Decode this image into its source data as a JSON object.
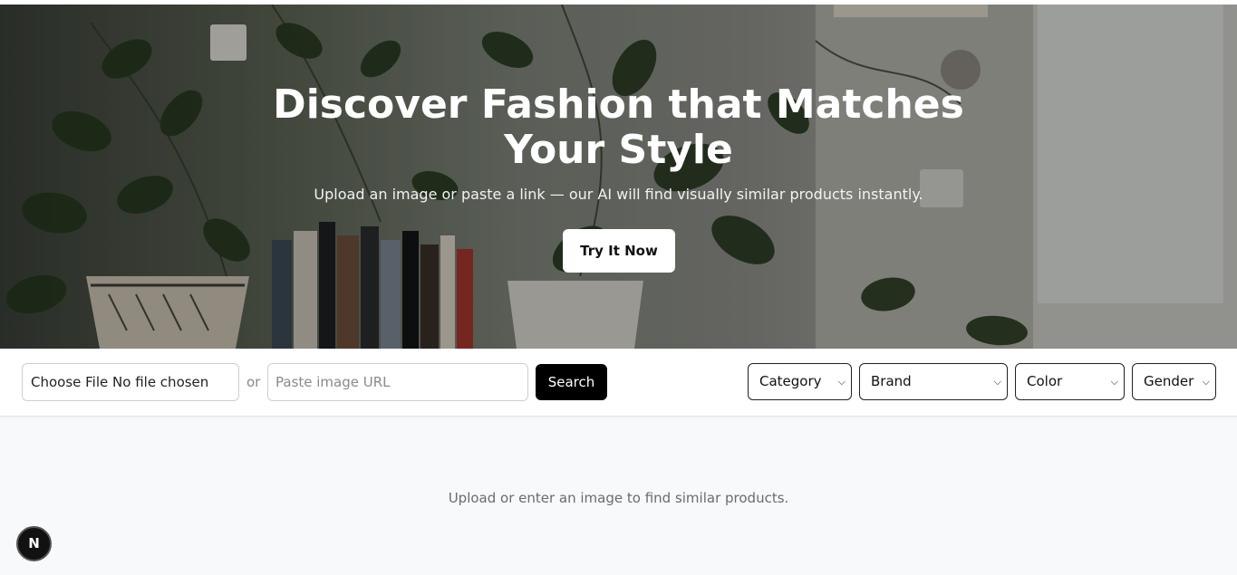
{
  "hero": {
    "title_line1": "Discover Fashion that Matches",
    "title_line2": "Your Style",
    "subtitle": "Upload an image or paste a link — our AI will find visually similar products instantly.",
    "cta_label": "Try It Now"
  },
  "search": {
    "file_button": "Choose File",
    "file_status": "No file chosen",
    "or_text": "or",
    "url_placeholder": "Paste image URL",
    "url_value": "",
    "search_label": "Search"
  },
  "filters": {
    "category": "Category",
    "brand": "Brand",
    "color": "Color",
    "gender": "Gender"
  },
  "empty_state": "Upload or enter an image to find similar products.",
  "dev_badge": "N",
  "colors": {
    "primary_button": "#000000",
    "cta_background": "#ffffff",
    "page_background": "#f8f9fa"
  }
}
